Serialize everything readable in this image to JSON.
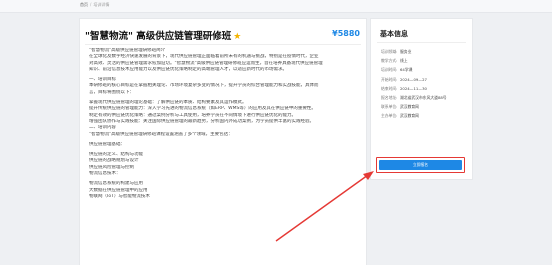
{
  "breadcrumb": {
    "home": "首页",
    "separator": "/",
    "current": "培训详情"
  },
  "course": {
    "title": "\"智慧物流\" 高级供应链管理研修班",
    "price": "¥5880",
    "star_icon": "star-icon",
    "description": [
      "\"智慧物流\"高级供应链管理研修班简介",
      "在全球化及数字经济快速发展的背景下，现代供应链管理正面临着前所未有的机遇与挑战，特别是在疫情时代，企业",
      "对高效、灵活的供应链管理需求愈加迫切。\"智慧物流\"高级供应链管理研修班应运而生，旨在培养具备现代供应链管理",
      "知识、前沿信息技术应用能力以及供应链优化策略制定的高端管理人才，以适应新时代的市场需求。",
      "",
      "一、培训目标",
      "本研修班的核心目标是在掌握相关理论、市场环境复杂多变的情况下，提升学员的综合管理能力和实战技能，具体而",
      "言，目标将围绕以下：",
      "",
      "掌握现代供应链管理的理论基础：了解供应链的本质、结构要素及其运作模式。",
      "提升传统供应链的管理能力：深入学习先进的物流信息系统（如ERP、WMS等）的应用及其在供应链中的重要性。",
      "制定有效的供应链优化策略：通过案例分析与工具使用，培养学员在不同情境下进行供应链优化的能力。",
      "增强团队协作与实践技能：关注国际供应链管理的最新趋势，分析国内外成功案例，为学员提供丰富的实践经验。",
      "二、培训内容",
      "\"智慧物流\"高级供应链管理研修班课程设置涵盖了多个领域，主要包括：",
      "",
      "供应链管理基础：",
      "",
      "供应链的定义、结构与功能",
      "供应链的战略规划与设计",
      "供应链风险管理与控制",
      "物流信息技术：",
      "",
      "物流信息系统的构建与应用",
      "大数据在供应链管理中的应用",
      "物联网（IoT）与智能物流技术"
    ]
  },
  "side": {
    "title": "基本信息",
    "rows": [
      {
        "label": "培训领域:",
        "value": "服务业"
      },
      {
        "label": "教学方式:",
        "value": "线上"
      },
      {
        "label": "培训时间:",
        "value": "64学课"
      },
      {
        "label": "开始时间:",
        "value": "2024—09—27"
      },
      {
        "label": "结束时间:",
        "value": "2024—11—30"
      },
      {
        "label": "报名地址:",
        "value": "湖北省武汉市东风大道88号"
      },
      {
        "label": "联系单位:",
        "value": "武汉教育网"
      },
      {
        "label": "主办单位:",
        "value": "武汉教育网"
      }
    ],
    "enroll_label": "立即报名"
  },
  "colors": {
    "accent": "#1e88e5",
    "highlight": "#e53935",
    "star": "#f4b400"
  }
}
